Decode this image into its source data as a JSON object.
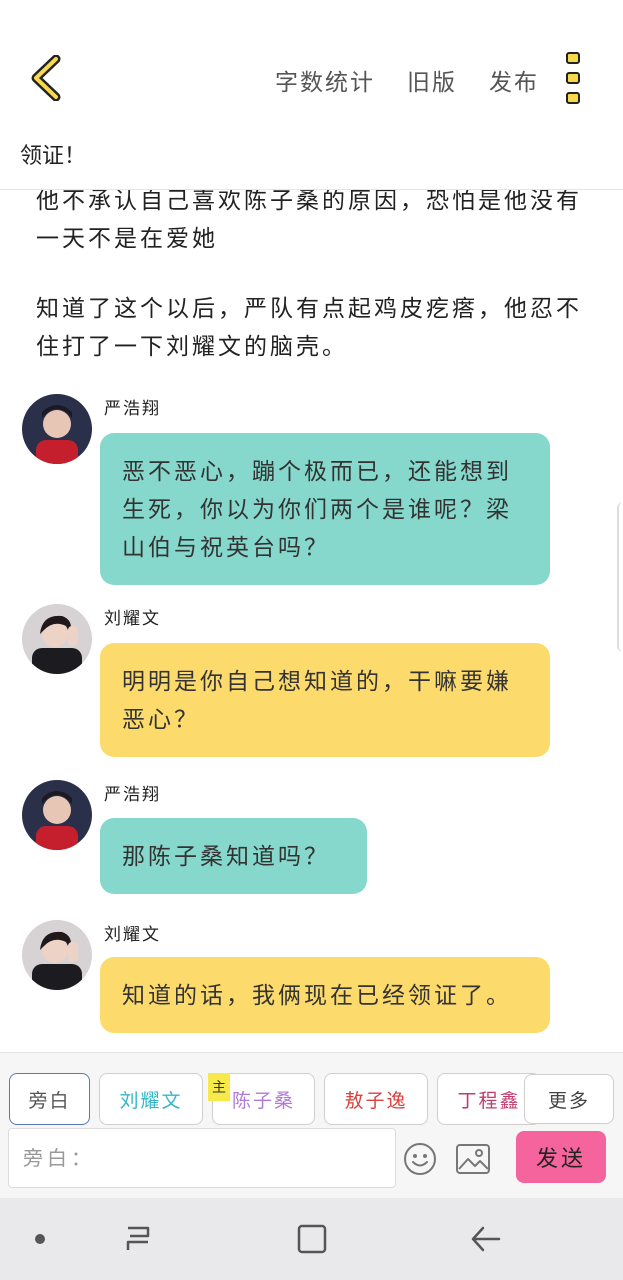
{
  "header": {
    "back_icon": "chevron-left-icon",
    "actions": [
      "字数统计",
      "旧版",
      "发布"
    ],
    "more_icon": "vertical-dots-icon",
    "title_value": "领证！"
  },
  "story": {
    "narration_1": "他不承认自己喜欢陈子桑的原因，恐怕是他没有一天不是在爱她",
    "narration_2": "知道了这个以后，严队有点起鸡皮疙瘩，他忍不住打了一下刘耀文的脑壳。",
    "messages": [
      {
        "sender": "严浩翔",
        "text": "恶不恶心，蹦个极而已，还能想到生死，你以为你们两个是谁呢？梁山伯与祝英台吗？",
        "color": "#86d8cd"
      },
      {
        "sender": "刘耀文",
        "text": "明明是你自己想知道的，干嘛要嫌恶心？",
        "color": "#fcdb6c"
      },
      {
        "sender": "严浩翔",
        "text": "那陈子桑知道吗？",
        "color": "#86d8cd"
      },
      {
        "sender": "刘耀文",
        "text": "知道的话，我俩现在已经领证了。",
        "color": "#fcdb6c"
      }
    ]
  },
  "roles": {
    "chips": [
      {
        "label": "旁白",
        "color": "#555555"
      },
      {
        "label": "刘耀文",
        "color": "#35b7c6"
      },
      {
        "label": "陈子桑",
        "color": "#b07ad8"
      },
      {
        "label": "敖子逸",
        "color": "#d8413f"
      },
      {
        "label": "丁程鑫",
        "color": "#c33a6d"
      },
      {
        "label": "更多",
        "color": "#444444"
      }
    ],
    "main_tag": "主"
  },
  "composer": {
    "placeholder": "旁白：",
    "emoji_icon": "emoji-icon",
    "image_icon": "image-icon",
    "send_label": "发送",
    "send_color": "#f5649c"
  },
  "system_nav": {
    "icons": [
      "dot-icon",
      "recents-icon",
      "home-icon",
      "back-arrow-icon"
    ]
  }
}
